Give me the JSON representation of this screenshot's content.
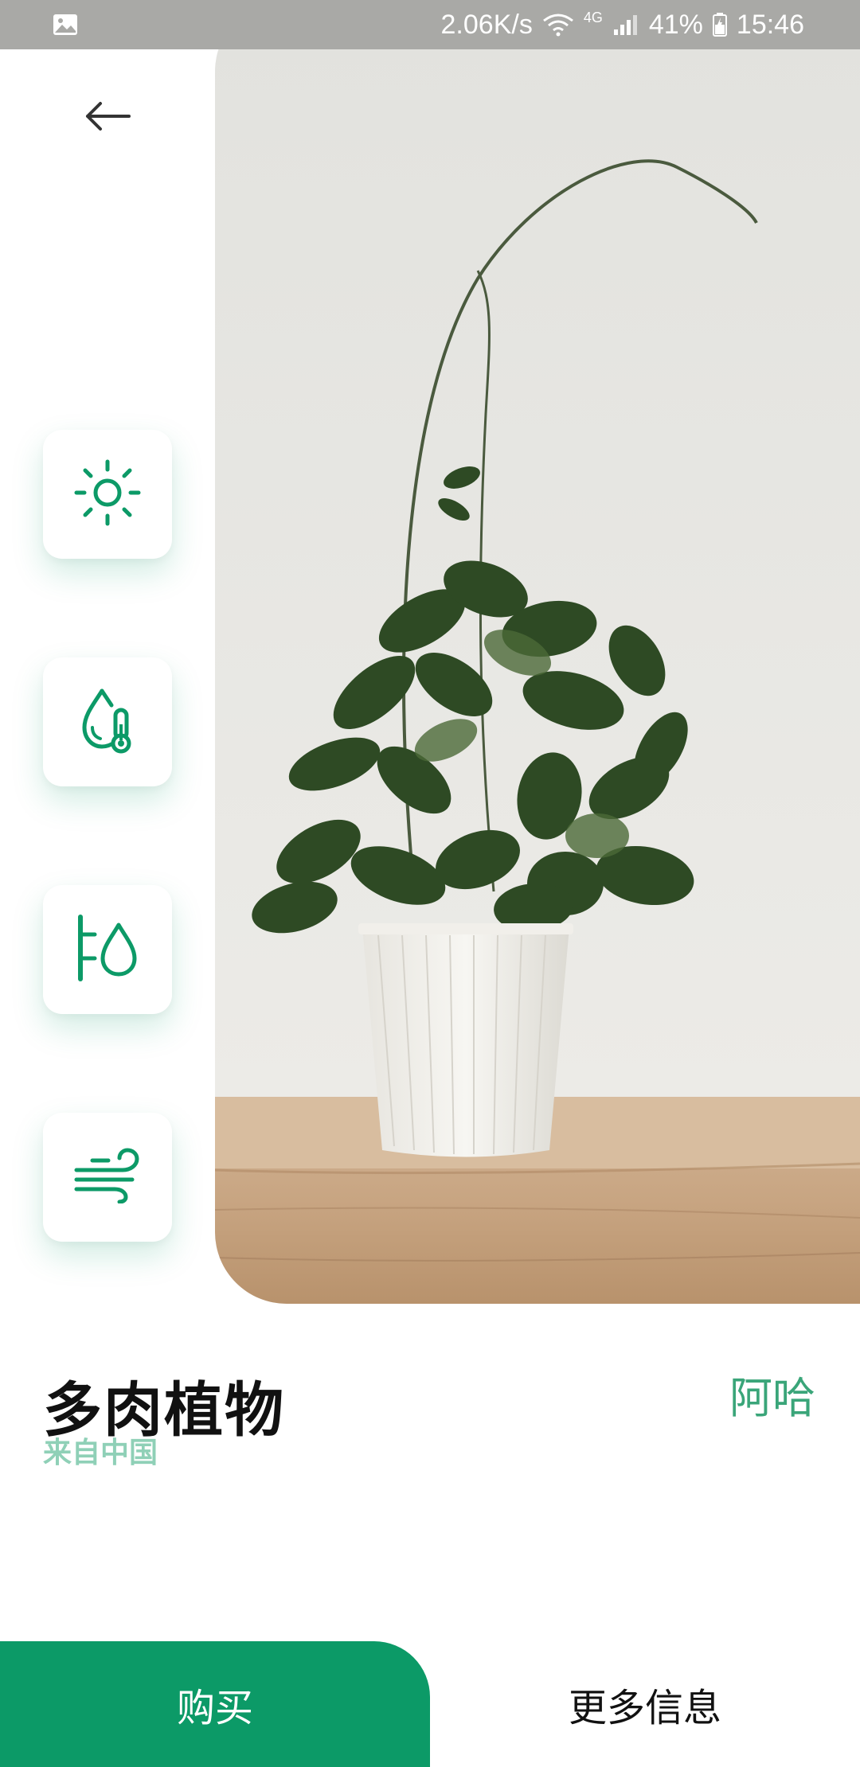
{
  "status_bar": {
    "speed": "2.06K/s",
    "network": "4G",
    "battery": "41%",
    "time": "15:46"
  },
  "care_icons": [
    "sun-icon",
    "humidity-temperature-icon",
    "watering-icon",
    "wind-icon"
  ],
  "plant": {
    "name": "多肉植物",
    "origin": "来自中国",
    "price": "阿哈"
  },
  "actions": {
    "buy_label": "购买",
    "more_label": "更多信息"
  },
  "colors": {
    "accent": "#0c9a67",
    "accent_light": "#8fd0b7",
    "price": "#3aa579"
  }
}
